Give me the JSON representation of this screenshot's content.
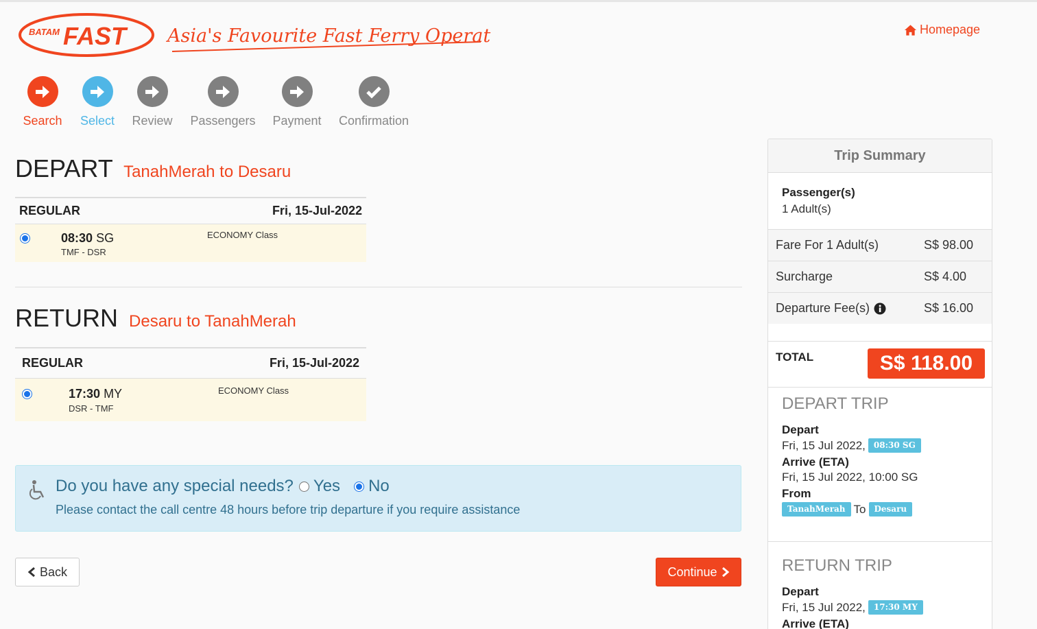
{
  "header": {
    "logo_brand_small": "BATAM",
    "logo_brand_big": "FAST",
    "logo_tagline": "Asia's Favourite Fast Ferry Operator",
    "homepage_label": "Homepage"
  },
  "steps": [
    {
      "label": "Search",
      "state": "done"
    },
    {
      "label": "Select",
      "state": "current"
    },
    {
      "label": "Review",
      "state": "todo"
    },
    {
      "label": "Passengers",
      "state": "todo"
    },
    {
      "label": "Payment",
      "state": "todo"
    },
    {
      "label": "Confirmation",
      "state": "todo"
    }
  ],
  "depart": {
    "title": "DEPART",
    "route": "TanahMerah to Desaru",
    "fare_type": "REGULAR",
    "date": "Fri, 15-Jul-2022",
    "time": "08:30",
    "tz": "SG",
    "code": "TMF - DSR",
    "class": "ECONOMY Class"
  },
  "return": {
    "title": "RETURN",
    "route": "Desaru to TanahMerah",
    "fare_type": "REGULAR",
    "date": "Fri, 15-Jul-2022",
    "time": "17:30",
    "tz": "MY",
    "code": "DSR - TMF",
    "class": "ECONOMY Class"
  },
  "special_needs": {
    "question": "Do you have any special needs?",
    "yes_label": "Yes",
    "no_label": "No",
    "selected": "No",
    "note": "Please contact the call centre 48 hours before trip departure if you require assistance"
  },
  "buttons": {
    "back": "Back",
    "continue": "Continue"
  },
  "summary": {
    "title": "Trip Summary",
    "passengers_label": "Passenger(s)",
    "passengers_value": "1 Adult(s)",
    "fare_label": "Fare For 1 Adult(s)",
    "fare_value": "S$ 98.00",
    "surcharge_label": "Surcharge",
    "surcharge_value": "S$ 4.00",
    "departure_fee_label": "Departure Fee(s)",
    "departure_fee_value": "S$ 16.00",
    "total_label": "TOTAL",
    "total_value": "S$ 118.00",
    "depart_trip": {
      "title": "DEPART TRIP",
      "depart_label": "Depart",
      "depart_date": "Fri, 15 Jul 2022,",
      "depart_time": "08:30 SG",
      "arrive_label": "Arrive (ETA)",
      "arrive_value": "Fri, 15 Jul 2022, 10:00 SG",
      "from_label": "From",
      "from_value": "TanahMerah",
      "to_label": "To",
      "to_value": "Desaru"
    },
    "return_trip": {
      "title": "RETURN TRIP",
      "depart_label": "Depart",
      "depart_date": "Fri, 15 Jul 2022,",
      "depart_time": "17:30 MY",
      "arrive_label": "Arrive (ETA)"
    }
  },
  "colors": {
    "brand": "#f0451f",
    "current_step": "#4fb6e6",
    "todo_step": "#808080",
    "info_bg": "#d9edf7",
    "badge": "#5bc0de"
  }
}
